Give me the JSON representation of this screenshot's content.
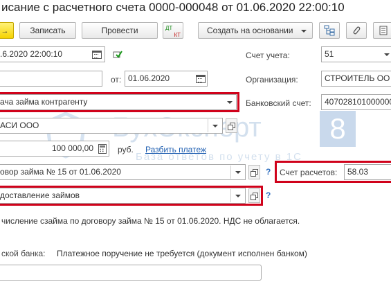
{
  "window": {
    "title": "исание с расчетного счета 0000-000048 от 01.06.2020 22:00:10"
  },
  "toolbar": {
    "write_label": "Записать",
    "post_label": "Провести",
    "create_based_label": "Создать на основании",
    "dt_label": "ДТ",
    "kt_label": "КТ"
  },
  "form": {
    "date_value": ".6.2020 22:00:10",
    "number_value": "",
    "from_label": "от:",
    "from_date": "01.06.2020",
    "operation_value": "ача займа контрагенту",
    "counterparty_value": "АСИ ООО",
    "amount_value": "100 000,00",
    "currency_label": "руб.",
    "split_link": "Разбить платеж",
    "contract_value": "овор займа № 15 от 01.06.2020",
    "flow_item_value": "доставление займов",
    "purpose_text": "числение сзайма по договору займа № 15 от 01.06.2020. НДС не облагается.",
    "bank_label": "ской банка:",
    "bank_status": "Платежное поручение не требуется (документ исполнен банком)",
    "right": {
      "account_label": "Счет учета:",
      "account_value": "51",
      "org_label": "Организация:",
      "org_value": "СТРОИТЕЛЬ ОО",
      "bank_account_label": "Банковский счет:",
      "bank_account_value": "407028101000000",
      "settlements_label": "Счет расчетов:",
      "settlements_value": "58.03"
    }
  },
  "watermark": {
    "brand": "БухЭксперт",
    "digit": "8",
    "tagline": "База ответов по учету в 1С"
  },
  "colors": {
    "highlight_border": "#d0021b",
    "link": "#1f5fb1",
    "accent_yellow": "#f6d300",
    "watermark": "#c9d9ec"
  }
}
